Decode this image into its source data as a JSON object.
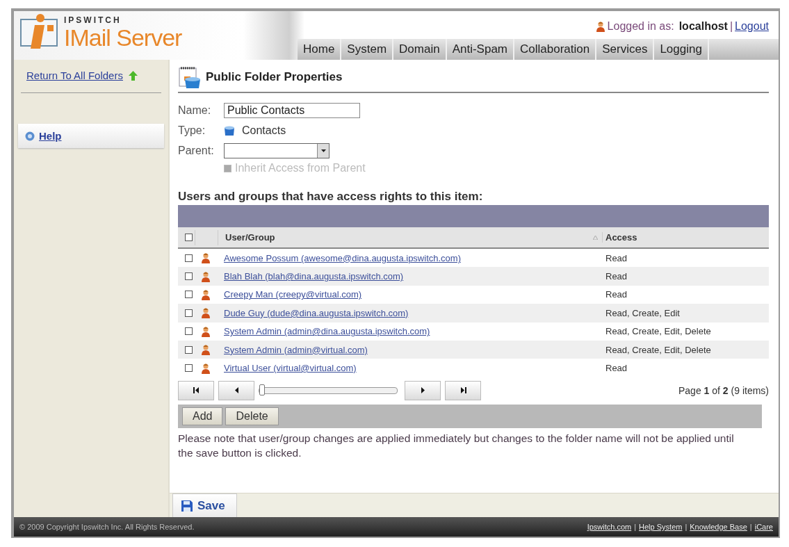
{
  "header": {
    "brand": "IPSWITCH",
    "product": "IMail Server",
    "user": {
      "prefix": "Logged in as:",
      "name": "localhost",
      "separator": "|",
      "logout": "Logout"
    },
    "nav": [
      "Home",
      "System",
      "Domain",
      "Anti-Spam",
      "Collaboration",
      "Services",
      "Logging"
    ]
  },
  "sidebar": {
    "return_link": "Return To All Folders",
    "help_link": "Help"
  },
  "page": {
    "title": "Public Folder Properties",
    "form": {
      "name_label": "Name:",
      "name_value": "Public Contacts",
      "type_label": "Type:",
      "type_value": "Contacts",
      "parent_label": "Parent:",
      "inherit": {
        "label": "Inherit Access from Parent",
        "checked": false,
        "disabled": true
      }
    },
    "access": {
      "heading": "Users and groups that have access rights to this item:",
      "select_all": {
        "checked": false
      },
      "columns": [
        "User/Group",
        "Access"
      ],
      "rows": [
        {
          "checked": false,
          "user": "Awesome Possum (awesome@dina.augusta.ipswitch.com)",
          "access": "Read"
        },
        {
          "checked": false,
          "user": "Blah Blah (blah@dina.augusta.ipswitch.com)",
          "access": "Read"
        },
        {
          "checked": false,
          "user": "Creepy Man (creepy@virtual.com)",
          "access": "Read"
        },
        {
          "checked": false,
          "user": "Dude Guy (dude@dina.augusta.ipswitch.com)",
          "access": "Read, Create, Edit"
        },
        {
          "checked": false,
          "user": "System Admin (admin@dina.augusta.ipswitch.com)",
          "access": "Read, Create, Edit, Delete"
        },
        {
          "checked": false,
          "user": "System Admin (admin@virtual.com)",
          "access": "Read, Create, Edit, Delete"
        },
        {
          "checked": false,
          "user": "Virtual User (virtual@virtual.com)",
          "access": "Read"
        }
      ],
      "pager": {
        "level": 0,
        "text": "Page **1** of **2** (9 items)"
      },
      "buttons": [
        "Add",
        "Delete"
      ]
    },
    "note": "Please note that user/group changes are applied immediately but changes to the folder name will not be applied until the save button is clicked.",
    "save": "Save"
  },
  "footer": {
    "copyright": "© 2009 Copyright Ipswitch Inc. All Rights Reserved.",
    "links": [
      "Ipswitch.com",
      "Help System",
      "Knowledge Base",
      "iCare"
    ],
    "separator": "|"
  }
}
